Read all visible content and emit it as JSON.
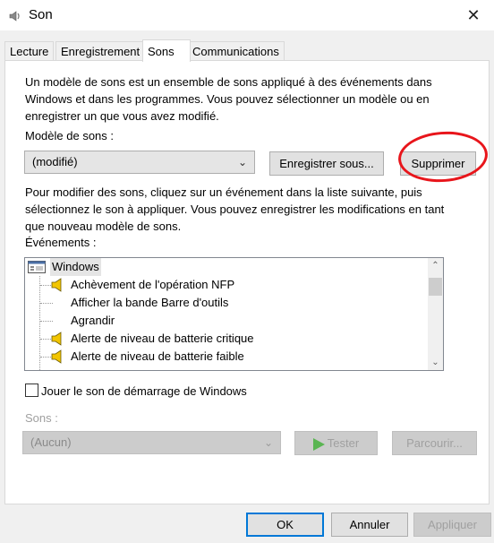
{
  "window": {
    "title": "Son"
  },
  "tabs": [
    {
      "label": "Lecture"
    },
    {
      "label": "Enregistrement"
    },
    {
      "label": "Sons"
    },
    {
      "label": "Communications"
    }
  ],
  "sons_tab": {
    "intro": "Un modèle de sons est un ensemble de sons appliqué à des événements dans Windows et dans les programmes. Vous pouvez sélectionner un modèle ou en enregistrer un que vous avez modifié.",
    "scheme_label": "Modèle de sons :",
    "scheme_value": "(modifié)",
    "save_as_label": "Enregistrer sous...",
    "delete_label": "Supprimer",
    "instructions": "Pour modifier des sons, cliquez sur un événement dans la liste suivante, puis sélectionnez le son à appliquer. Vous pouvez enregistrer les modifications en tant que nouveau modèle de sons.",
    "events_label": "Événements :",
    "events": [
      {
        "label": "Windows",
        "icon": "windows-app-icon",
        "has_sound": false
      },
      {
        "label": "Achèvement de l'opération NFP",
        "icon": "speaker-icon",
        "has_sound": true
      },
      {
        "label": "Afficher la bande Barre d'outils",
        "icon": "",
        "has_sound": false
      },
      {
        "label": "Agrandir",
        "icon": "",
        "has_sound": false
      },
      {
        "label": "Alerte de niveau de batterie critique",
        "icon": "speaker-icon",
        "has_sound": true
      },
      {
        "label": "Alerte de niveau de batterie faible",
        "icon": "speaker-icon",
        "has_sound": true
      }
    ],
    "startup_sound_label": "Jouer le son de démarrage de Windows",
    "startup_sound_checked": false,
    "sounds_label": "Sons :",
    "sound_value": "(Aucun)",
    "test_label": "Tester",
    "browse_label": "Parcourir..."
  },
  "footer": {
    "ok_label": "OK",
    "cancel_label": "Annuler",
    "apply_label": "Appliquer"
  },
  "colors": {
    "accent": "#0078d7",
    "annotation": "#e8151b",
    "speaker": "#f2c500"
  }
}
